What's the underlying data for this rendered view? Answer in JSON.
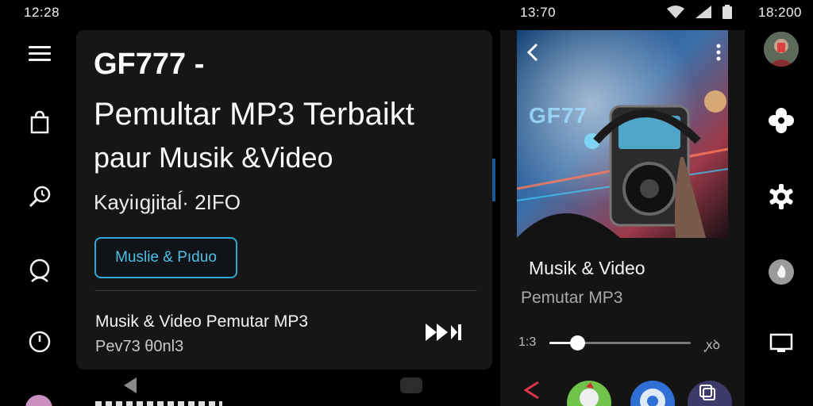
{
  "status": {
    "time_left": "12:28",
    "time_mid": "13:70",
    "time_right": "18:200"
  },
  "left_rail": {
    "icons": [
      "menu-icon",
      "bag-icon",
      "search-history-icon",
      "user-icon",
      "power-icon"
    ]
  },
  "main": {
    "title_line1": "GF777 -",
    "title_line2": "Pemultar MP3 Terbaikt",
    "title_line3": "paur Musik &Video",
    "meta": "Kayiıgjitaĺ· 2IFO",
    "pill_label": "Muslie & Pıduo",
    "now_playing": {
      "title": "Musik & Video Pemutar MP3",
      "subtitle": "Pev73 θ0nl3"
    }
  },
  "player": {
    "art_logo": "GF77",
    "title": "Musik & Video",
    "subtitle": "Pemutar MP3",
    "elapsed": "1:3",
    "remaining": "ꭙꝺ",
    "progress": 0.2,
    "colors": {
      "accent": "#2fa8d6",
      "card": "#161616"
    }
  },
  "right_rail": {
    "icons": [
      "avatar",
      "flower-icon",
      "gear-icon",
      "disc-icon",
      "cast-icon"
    ]
  }
}
